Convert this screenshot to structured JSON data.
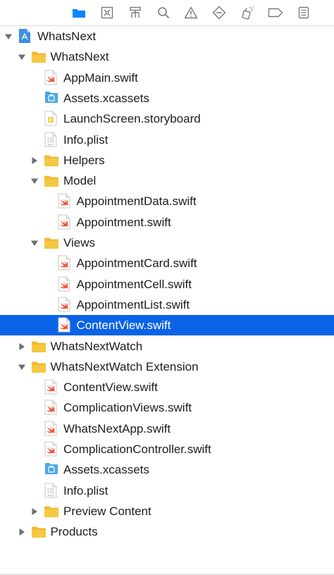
{
  "toolbar": {
    "buttons": [
      {
        "icon": "folder-icon",
        "selected": true
      },
      {
        "icon": "source-control-icon",
        "selected": false
      },
      {
        "icon": "symbol-hierarchy-icon",
        "selected": false
      },
      {
        "icon": "search-icon",
        "selected": false
      },
      {
        "icon": "warning-icon",
        "selected": false
      },
      {
        "icon": "diamond-test-icon",
        "selected": false
      },
      {
        "icon": "debug-spray-icon",
        "selected": false
      },
      {
        "icon": "breakpoint-icon",
        "selected": false
      },
      {
        "icon": "report-icon",
        "selected": false
      }
    ],
    "accent_color": "#0a84ff"
  },
  "colors": {
    "selection": "#0a63e6",
    "folder": "#f5c842",
    "swift": "#f05138",
    "assets": "#4aa8e8"
  },
  "tree": [
    {
      "label": "WhatsNext",
      "type": "project",
      "level": 0,
      "disclosure": "open"
    },
    {
      "label": "WhatsNext",
      "type": "folder",
      "level": 1,
      "disclosure": "open"
    },
    {
      "label": "AppMain.swift",
      "type": "swift",
      "level": 2,
      "disclosure": "none"
    },
    {
      "label": "Assets.xcassets",
      "type": "assets",
      "level": 2,
      "disclosure": "none"
    },
    {
      "label": "LaunchScreen.storyboard",
      "type": "storyboard",
      "level": 2,
      "disclosure": "none"
    },
    {
      "label": "Info.plist",
      "type": "plist",
      "level": 2,
      "disclosure": "none"
    },
    {
      "label": "Helpers",
      "type": "folder",
      "level": 2,
      "disclosure": "closed"
    },
    {
      "label": "Model",
      "type": "folder",
      "level": 2,
      "disclosure": "open"
    },
    {
      "label": "AppointmentData.swift",
      "type": "swift",
      "level": 3,
      "disclosure": "none"
    },
    {
      "label": "Appointment.swift",
      "type": "swift",
      "level": 3,
      "disclosure": "none"
    },
    {
      "label": "Views",
      "type": "folder",
      "level": 2,
      "disclosure": "open"
    },
    {
      "label": "AppointmentCard.swift",
      "type": "swift",
      "level": 3,
      "disclosure": "none"
    },
    {
      "label": "AppointmentCell.swift",
      "type": "swift",
      "level": 3,
      "disclosure": "none"
    },
    {
      "label": "AppointmentList.swift",
      "type": "swift",
      "level": 3,
      "disclosure": "none"
    },
    {
      "label": "ContentView.swift",
      "type": "swift",
      "level": 3,
      "disclosure": "none",
      "selected": true
    },
    {
      "label": "WhatsNextWatch",
      "type": "folder",
      "level": 1,
      "disclosure": "closed"
    },
    {
      "label": "WhatsNextWatch Extension",
      "type": "folder",
      "level": 1,
      "disclosure": "open"
    },
    {
      "label": "ContentView.swift",
      "type": "swift",
      "level": 2,
      "disclosure": "none"
    },
    {
      "label": "ComplicationViews.swift",
      "type": "swift",
      "level": 2,
      "disclosure": "none"
    },
    {
      "label": "WhatsNextApp.swift",
      "type": "swift",
      "level": 2,
      "disclosure": "none"
    },
    {
      "label": "ComplicationController.swift",
      "type": "swift",
      "level": 2,
      "disclosure": "none"
    },
    {
      "label": "Assets.xcassets",
      "type": "assets",
      "level": 2,
      "disclosure": "none"
    },
    {
      "label": "Info.plist",
      "type": "plist",
      "level": 2,
      "disclosure": "none"
    },
    {
      "label": "Preview Content",
      "type": "folder",
      "level": 2,
      "disclosure": "closed"
    },
    {
      "label": "Products",
      "type": "folder",
      "level": 1,
      "disclosure": "closed"
    }
  ]
}
